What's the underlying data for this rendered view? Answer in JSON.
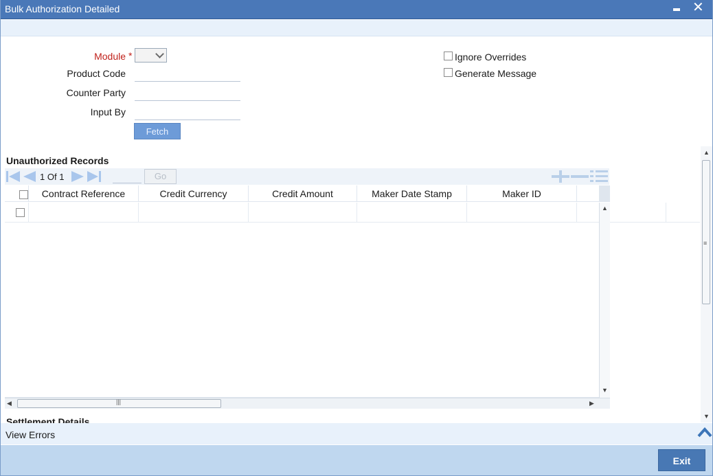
{
  "window": {
    "title": "Bulk Authorization Detailed"
  },
  "form": {
    "module_label": "Module",
    "required_mark": "*",
    "module_value": "",
    "product_code_label": "Product Code",
    "product_code_value": "",
    "counter_party_label": "Counter Party",
    "counter_party_value": "",
    "input_by_label": "Input By",
    "input_by_value": "",
    "fetch_label": "Fetch",
    "ignore_overrides_label": "Ignore Overrides",
    "ignore_overrides_checked": false,
    "generate_message_label": "Generate Message",
    "generate_message_checked": false
  },
  "unauthorized": {
    "title": "Unauthorized Records",
    "pager": {
      "current_page": "1",
      "of_label": "Of",
      "total_pages": "1",
      "go_label": "Go"
    },
    "columns": [
      "Contract Reference",
      "Credit Currency",
      "Credit Amount",
      "Maker Date Stamp",
      "Maker ID"
    ],
    "rows": [
      {
        "checked": false,
        "cells": [
          "",
          "",
          "",
          "",
          ""
        ]
      }
    ]
  },
  "settlement": {
    "title": "Settlement Details"
  },
  "errors": {
    "label": "View Errors"
  },
  "footer": {
    "exit_label": "Exit"
  },
  "colors": {
    "titlebar": "#4a78b8",
    "required": "#c0211b",
    "button": "#4878b4",
    "footer": "#bfd7ef"
  }
}
